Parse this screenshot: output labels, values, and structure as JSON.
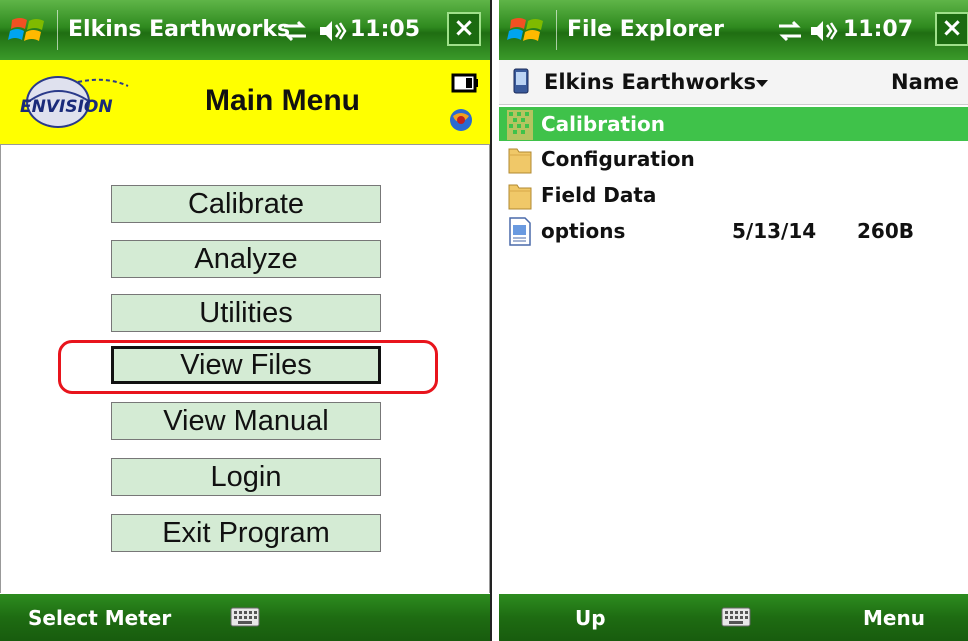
{
  "left_device": {
    "titlebar": {
      "title": "Elkins Earthworks",
      "time": "11:05",
      "close": "×"
    },
    "header": {
      "title": "Main Menu",
      "logo_text": "ENVISION"
    },
    "menu": [
      {
        "label": "Calibrate",
        "focused": false
      },
      {
        "label": "Analyze",
        "focused": false
      },
      {
        "label": "Utilities",
        "focused": false
      },
      {
        "label": "View Files",
        "focused": true
      },
      {
        "label": "View Manual",
        "focused": false
      },
      {
        "label": "Login",
        "focused": false
      },
      {
        "label": "Exit Program",
        "focused": false
      }
    ],
    "softkeys": {
      "left": "Select Meter"
    }
  },
  "right_device": {
    "titlebar": {
      "title": "File Explorer",
      "time": "11:07",
      "close": "×"
    },
    "folder_bar": {
      "folder": "Elkins Earthworks",
      "sort": "Name"
    },
    "files": [
      {
        "name": "Calibration",
        "type": "folder",
        "date": "",
        "size": "",
        "selected": true
      },
      {
        "name": "Configuration",
        "type": "folder",
        "date": "",
        "size": "",
        "selected": false
      },
      {
        "name": "Field Data",
        "type": "folder",
        "date": "",
        "size": "",
        "selected": false
      },
      {
        "name": "options",
        "type": "file",
        "date": "5/13/14",
        "size": "260B",
        "selected": false
      }
    ],
    "softkeys": {
      "left": "Up",
      "right": "Menu"
    }
  },
  "colors": {
    "titlebar_green": "#2f8a1f",
    "header_yellow": "#ffff00",
    "button_green": "#d4ebd4",
    "selection_green": "#3fc24a",
    "highlight_red": "#e8141c"
  }
}
